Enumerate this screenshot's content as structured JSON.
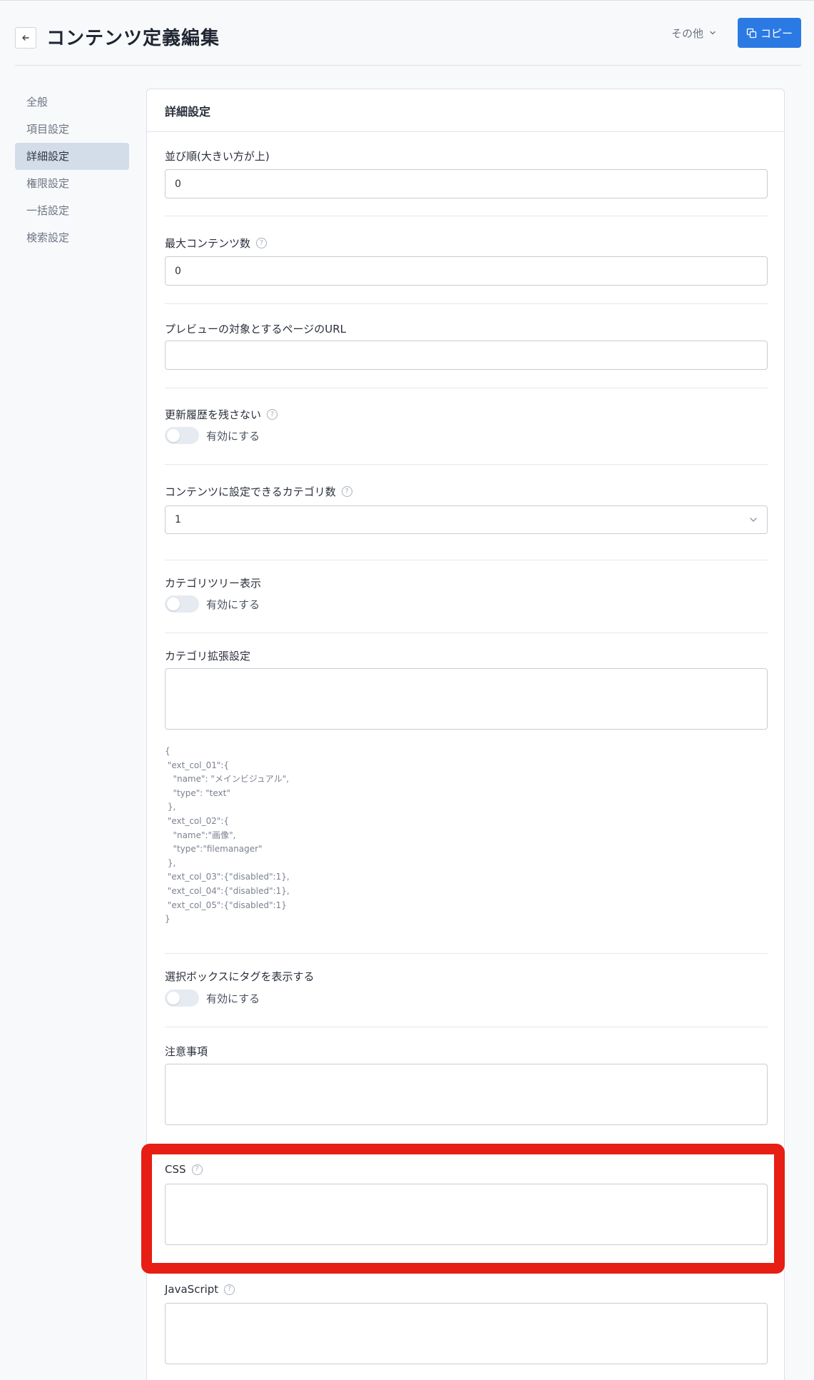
{
  "header": {
    "title": "コンテンツ定義編集",
    "other_label": "その他",
    "copy_label": "コピー"
  },
  "sidebar": {
    "items": [
      {
        "label": "全般"
      },
      {
        "label": "項目設定"
      },
      {
        "label": "詳細設定",
        "active": true
      },
      {
        "label": "権限設定"
      },
      {
        "label": "一括設定"
      },
      {
        "label": "検索設定"
      }
    ]
  },
  "card": {
    "title": "詳細設定",
    "sort_order": {
      "label": "並び順(大きい方が上)",
      "value": "0"
    },
    "max_contents": {
      "label": "最大コンテンツ数",
      "value": "0"
    },
    "preview_url": {
      "label": "プレビューの対象とするページのURL",
      "value": ""
    },
    "no_history": {
      "label": "更新履歴を残さない",
      "toggle_label": "有効にする",
      "enabled": false
    },
    "category_count": {
      "label": "コンテンツに設定できるカテゴリ数",
      "value": "1"
    },
    "category_tree": {
      "label": "カテゴリツリー表示",
      "toggle_label": "有効にする",
      "enabled": false
    },
    "category_ext": {
      "label": "カテゴリ拡張設定",
      "value": "",
      "sample": "{\n \"ext_col_01\":{\n   \"name\": \"メインビジュアル\",\n   \"type\": \"text\"\n },\n \"ext_col_02\":{\n   \"name\":\"画像\",\n   \"type\":\"filemanager\"\n },\n \"ext_col_03\":{\"disabled\":1},\n \"ext_col_04\":{\"disabled\":1},\n \"ext_col_05\":{\"disabled\":1}\n}"
    },
    "select_tags": {
      "label": "選択ボックスにタグを表示する",
      "toggle_label": "有効にする",
      "enabled": false
    },
    "notes": {
      "label": "注意事項",
      "value": ""
    },
    "css": {
      "label": "CSS",
      "value": ""
    },
    "javascript": {
      "label": "JavaScript",
      "value": ""
    }
  },
  "colors": {
    "primary": "#2b7ae4",
    "highlight": "#e61e14",
    "active_nav": "#d3dde9"
  }
}
